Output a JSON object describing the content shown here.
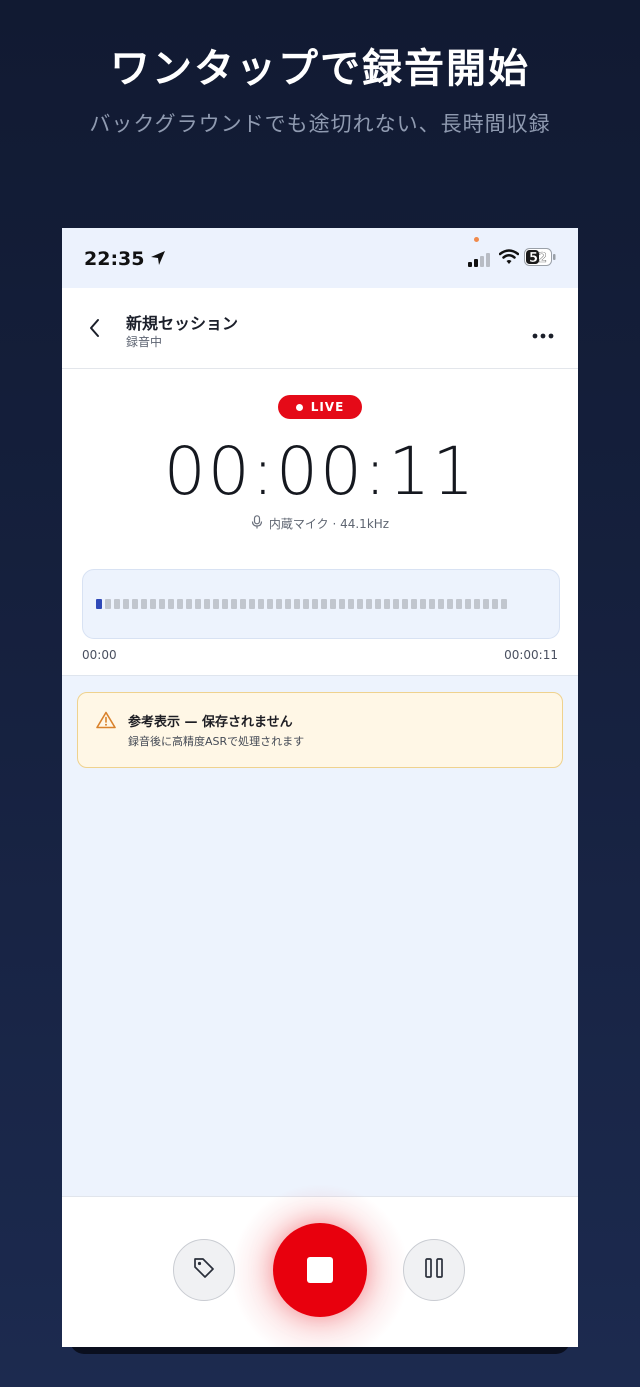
{
  "promo": {
    "headline": "ワンタップで録音開始",
    "subline": "バックグラウンドでも途切れない、長時間収録"
  },
  "status_bar": {
    "time": "22:35",
    "battery": "52"
  },
  "header": {
    "title": "新規セッション",
    "subtitle": "録音中"
  },
  "recorder": {
    "live_label": "LIVE",
    "elapsed": "00:00:11",
    "source": "内蔵マイク · 44.1kHz",
    "timeline_start": "00:00",
    "timeline_end": "00:00:11",
    "waveform_active_bars": 1,
    "waveform_total_bars": 46
  },
  "notice": {
    "title": "参考表示 — 保存されません",
    "body": "録音後に高精度ASRで処理されます"
  },
  "colors": {
    "accent_red": "#e8000d",
    "wave_active": "#2f49b8",
    "notice_bg": "#fff7e6"
  },
  "icons": [
    "location-arrow-icon",
    "cellular-signal-icon",
    "wifi-icon",
    "battery-icon",
    "chevron-left-icon",
    "more-horizontal-icon",
    "microphone-icon",
    "warning-triangle-icon",
    "tag-icon",
    "stop-icon",
    "pause-icon"
  ]
}
